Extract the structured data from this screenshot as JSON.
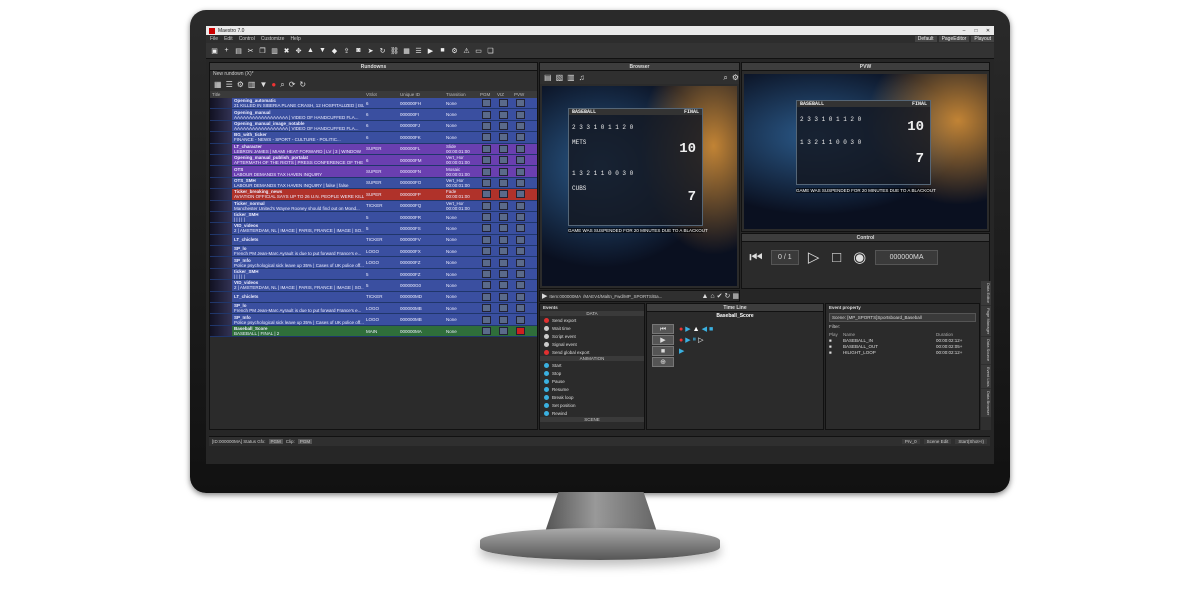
{
  "app": {
    "title": "Maestro 7.0"
  },
  "menu": [
    "File",
    "Edit",
    "Control",
    "Customize",
    "Help"
  ],
  "layouts": [
    "Default",
    "PageEditor",
    "Playout"
  ],
  "panels": {
    "rundowns": "Rundowns",
    "browser": "Browser",
    "pvw": "PVW",
    "control": "Control",
    "timeline": "Time Line",
    "events": "Events",
    "event_property": "Event property"
  },
  "rundown": {
    "tab": "New rundown (X)*",
    "columns": [
      "Title",
      "VSlot",
      "Unique ID",
      "Transition",
      "PGM",
      "VIZ",
      "PVW"
    ],
    "rows": [
      {
        "name": "Opening_automatic",
        "desc": "21 KILLED IN SIBERIA PLANE CRASH, 12 HOSPITALIZED | ISLA...",
        "vslot": "6",
        "uid": "000000FH",
        "trans": "None",
        "color": "#3a4fa0"
      },
      {
        "name": "Opening_manual",
        "desc": "AAAAAAAAAAAAAAAAAA | VIDEO OF HANDCUFFED FLA...",
        "vslot": "6",
        "uid": "000000FI",
        "trans": "None",
        "color": "#3a4fa0"
      },
      {
        "name": "Opening_manual_image_notable",
        "desc": "AAAAAAAAAAAAAAAAAA | VIDEO OF HANDCUFFED FLA...",
        "vslot": "6",
        "uid": "000000FJ",
        "trans": "None",
        "color": "#3a4fa0"
      },
      {
        "name": "BG_with_ticker",
        "desc": "FINANCE - NEWS - SPORT - CULTURE - POLITIC...",
        "vslot": "6",
        "uid": "000000FK",
        "trans": "None",
        "color": "#3a4fa0"
      },
      {
        "name": "LT_character",
        "desc": "LEBRON JAMES | MIAMI HEAT FORWARD | LV | 3 | WINDOW",
        "vslot": "SUPER",
        "uid": "000000FL",
        "trans": "Slide",
        "dur": "00:00:01:00",
        "color": "#6a3fb0"
      },
      {
        "name": "Opening_manual_publish_portalat",
        "desc": "AFTERMATH OF THE RIOTS | PRESS CONFERENCE OF THE PE...",
        "vslot": "6",
        "uid": "000000FM",
        "trans": "Vert_Hor",
        "dur": "00:00:01:00",
        "color": "#6a3fb0"
      },
      {
        "name": "OTS",
        "desc": "LABOUR DEMANDS TAX HAVEN INQUIRY",
        "vslot": "SUPER",
        "uid": "000000FN",
        "trans": "Mosaic",
        "dur": "00:00:01:00",
        "color": "#6a3fb0"
      },
      {
        "name": "OTS_SMH",
        "desc": "LABOUR DEMANDS TAX HAVEN INQUIRY | false | false",
        "vslot": "SUPER",
        "uid": "000000FO",
        "trans": "Vert_Hor",
        "dur": "00:00:01:00",
        "color": "#3a4fa0"
      },
      {
        "name": "Ticker_breaking_news",
        "desc": "AVIATION OFFICIAL SAYS UP TO 26 U.N. PEOPLE WERE KILLED...",
        "vslot": "SUPER",
        "uid": "000000FP",
        "trans": "Fade",
        "dur": "00:00:01:00",
        "color": "#b0322a"
      },
      {
        "name": "Ticker_normal",
        "desc": "Manchester United's Wayne Rooney should find out on Mond...",
        "vslot": "TICKER",
        "uid": "000000FQ",
        "trans": "Vert_Hor",
        "dur": "00:00:01:00",
        "color": "#3a4fa0"
      },
      {
        "name": "ticker_SMH",
        "desc": "| | | | |",
        "vslot": "5",
        "uid": "000000FR",
        "trans": "None",
        "color": "#3a4fa0"
      },
      {
        "name": "VID_videos",
        "desc": "2 | AMSTERDAM, NL | IMAGE | PARIS, FRANCE | IMAGE | SO...",
        "vslot": "5",
        "uid": "000000FS",
        "trans": "None",
        "color": "#3a4fa0"
      },
      {
        "name": "LT_chiclets",
        "desc": "",
        "vslot": "TICKER",
        "uid": "000000FV",
        "trans": "None",
        "color": "#3a4fa0"
      },
      {
        "name": "SP_lo",
        "desc": "French PM Jean-Marc Ayrault is due to put forward France's e...",
        "vslot": "LOGO",
        "uid": "000000FX",
        "trans": "None",
        "color": "#3a4fa0"
      },
      {
        "name": "SP_Info",
        "desc": "Police psychological sick leave up 35% | Cases of UK police off...",
        "vslot": "LOGO",
        "uid": "000000FZ",
        "trans": "None",
        "color": "#3a4fa0"
      },
      {
        "name": "ticker_SMH",
        "desc": "| | | | |",
        "vslot": "5",
        "uid": "000000FZ",
        "trans": "None",
        "color": "#3a4fa0"
      },
      {
        "name": "VID_videos",
        "desc": "2 | AMSTERDAM, NL | IMAGE | PARIS, FRANCE | IMAGE | SO...",
        "vslot": "5",
        "uid": "000000G0",
        "trans": "None",
        "color": "#3a4fa0"
      },
      {
        "name": "LT_chiclets",
        "desc": "",
        "vslot": "TICKER",
        "uid": "000000MD",
        "trans": "None",
        "color": "#3a4fa0"
      },
      {
        "name": "SP_lo",
        "desc": "French PM Jean-Marc Ayrault is due to put forward France's e...",
        "vslot": "LOGO",
        "uid": "000000MB",
        "trans": "None",
        "color": "#3a4fa0"
      },
      {
        "name": "SP_Info",
        "desc": "Police psychological sick leave up 35% | Cases of UK police off...",
        "vslot": "LOGO",
        "uid": "000000MB",
        "trans": "None",
        "color": "#3a4fa0"
      },
      {
        "name": "Baseball_Score",
        "desc": "BASEBALL | FINAL | 2",
        "vslot": "MAIN",
        "uid": "000000MA",
        "trans": "None",
        "color": "#2f6e3a"
      }
    ]
  },
  "scoreboard": {
    "title": "BASEBALL",
    "status": "FINAL",
    "team1": "METS",
    "team2": "CUBS",
    "score1": "10",
    "score2": "7",
    "innings_1": "2 3 3 1 0 1 1 2 0",
    "innings_2": "1 3 2 1 1 0 0 3 0",
    "message": "GAME WAS SUSPENDED FOR 20 MINUTES DUE TO A BLACKOUT"
  },
  "browser": {
    "path": "Item:000000MA",
    "path_long": "/MAEV4/Maltn_Fwd/MP_SPORTS/Ba..."
  },
  "control": {
    "counter": "0 / 1",
    "item_id": "000000MA"
  },
  "events_panel": {
    "data_header": "DATA",
    "data": [
      "Send export",
      "Wait time",
      "Script event",
      "Signal event",
      "Send global export"
    ],
    "animation_header": "ANIMATION",
    "animation": [
      "Start",
      "Stop",
      "Pause",
      "Resume",
      "Break loop",
      "Set position",
      "Rewind"
    ],
    "scene_header": "SCENE"
  },
  "timeline": {
    "title": "Baseball_Score"
  },
  "event_property": {
    "scene": "Scene: [MP_SPORTS]Sportsboard_Baseball",
    "filter": "Filter:",
    "cols": [
      "Play",
      "Name",
      "Duration"
    ],
    "rows": [
      {
        "name": "BASEBALL_IN",
        "dur": "00:00:02:12+"
      },
      {
        "name": "BASEBALL_OUT",
        "dur": "00:00:02:05+"
      },
      {
        "name": "HILIGHT_LOOP",
        "dur": "00:00:02:12+"
      }
    ]
  },
  "side_tabs": [
    "Data Editor",
    "Page Manager",
    "Data Source",
    "Event Lists",
    "Data Browser"
  ],
  "status": {
    "left": "[ID:000000MA] Status Gfx:",
    "pgm": "PGM",
    "clip": "Clip:",
    "buttons": [
      "Prv_0",
      "Scene Edit",
      "Start(Shot+I)"
    ]
  }
}
